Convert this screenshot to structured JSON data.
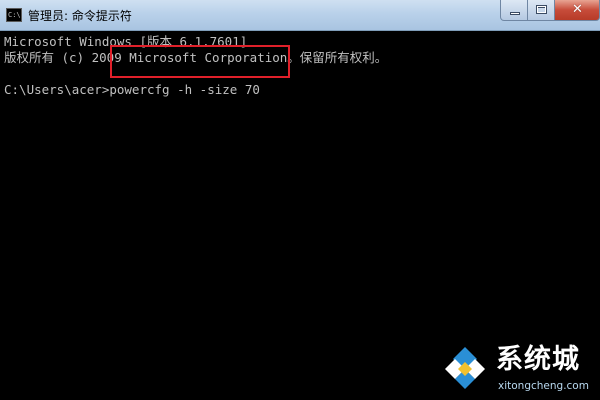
{
  "window": {
    "title": "管理员: 命令提示符",
    "icon": "cmd-icon",
    "icon_text": "C:\\"
  },
  "controls": {
    "minimize": "minimize-icon",
    "maximize": "maximize-icon",
    "close": "close-icon",
    "close_glyph": "✕"
  },
  "console": {
    "lines": [
      "Microsoft Windows [版本 6.1.7601]",
      "版权所有 (c) 2009 Microsoft Corporation。保留所有权利。"
    ],
    "prompt": "C:\\Users\\acer>",
    "command": "powercfg -h -size 70",
    "text_color": "#c0c0c0",
    "background": "#000000",
    "highlight_color": "#e0202a"
  },
  "watermark": {
    "name": "系统城",
    "url": "xitongcheng.com",
    "icon": "xitongcheng-logo-icon"
  }
}
